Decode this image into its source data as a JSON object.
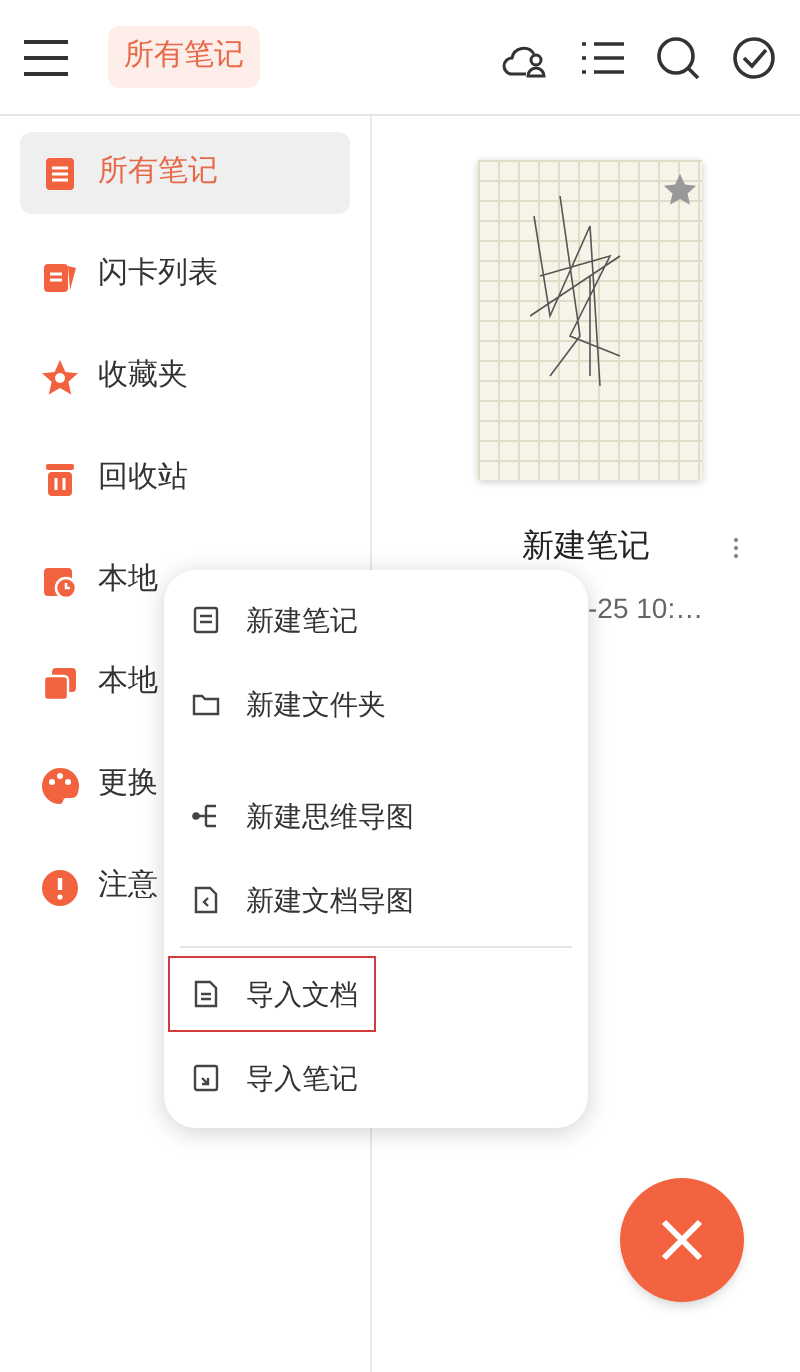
{
  "header": {
    "title": "所有笔记"
  },
  "sidebar": {
    "items": [
      {
        "kind": "notes",
        "label": "所有笔记",
        "selected": true
      },
      {
        "kind": "cards",
        "label": "闪卡列表",
        "selected": false
      },
      {
        "kind": "star",
        "label": "收藏夹",
        "selected": false
      },
      {
        "kind": "trash",
        "label": "回收站",
        "selected": false
      },
      {
        "kind": "history",
        "label": "本地",
        "selected": false
      },
      {
        "kind": "copies",
        "label": "本地",
        "selected": false
      },
      {
        "kind": "palette",
        "label": "更换",
        "selected": false
      },
      {
        "kind": "alert",
        "label": "注意",
        "selected": false
      }
    ]
  },
  "note": {
    "title": "新建笔记",
    "date": "-25 10:…",
    "starred": true
  },
  "menu": {
    "items": [
      {
        "kind": "note",
        "label": "新建笔记",
        "highlighted": false
      },
      {
        "kind": "folder",
        "label": "新建文件夹",
        "highlighted": false
      },
      {
        "kind": "mindmap",
        "label": "新建思维导图",
        "highlighted": false,
        "gap": true
      },
      {
        "kind": "docmap",
        "label": "新建文档导图",
        "highlighted": false
      },
      {
        "kind": "import-doc",
        "label": "导入文档",
        "highlighted": true,
        "divider": true
      },
      {
        "kind": "import-note",
        "label": "导入笔记",
        "highlighted": false
      }
    ]
  }
}
